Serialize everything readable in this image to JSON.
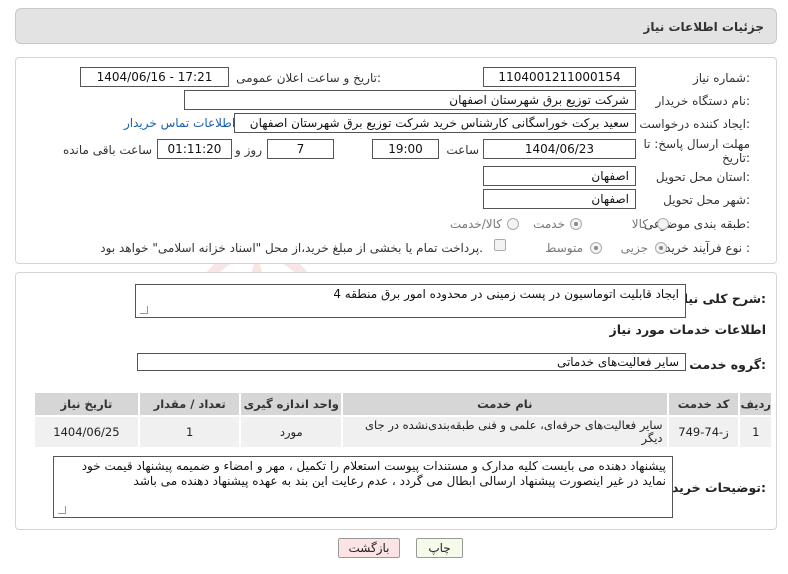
{
  "header": {
    "title": "جزئیات اطلاعات نیاز"
  },
  "watermark": {
    "text": "AriaTender.net"
  },
  "form": {
    "need_number_label": "شماره نیاز:",
    "need_number": "1104001211000154",
    "announce_label": "تاریخ و ساعت اعلان عمومی:",
    "announce_value": "1404/06/16 - 17:21",
    "buyer_org_label": "نام دستگاه خریدار:",
    "buyer_org": "شرکت توزیع برق شهرستان اصفهان",
    "creator_label": "ایجاد کننده درخواست:",
    "creator": "سعید برکت خوراسگانی کارشناس خرید شرکت توزیع برق شهرستان اصفهان",
    "buyer_contact_link": "اطلاعات تماس خریدار",
    "deadline_label_1": "مهلت ارسال پاسخ: تا",
    "deadline_label_2": "تاریخ:",
    "deadline_date": "1404/06/23",
    "time_label": "ساعت",
    "deadline_time": "19:00",
    "days_value": "7",
    "days_label": "روز و",
    "remaining_time": "01:11:20",
    "remaining_label": "ساعت باقی مانده",
    "province_label": "استان محل تحویل:",
    "province": "اصفهان",
    "city_label": "شهر محل تحویل:",
    "city": "اصفهان",
    "category_label": "طبقه بندی موضوعی:",
    "category_options": [
      "کالا",
      "خدمت",
      "کالا/خدمت"
    ],
    "category_selected": "خدمت",
    "process_label": "نوع فرآیند خرید :",
    "process_options": [
      "جزیی",
      "متوسط"
    ],
    "process_selected": "جزیی",
    "payment_note": "پرداخت تمام یا بخشی از مبلغ خرید،از محل \"اسناد خزانه اسلامی\" خواهد بود."
  },
  "summary": {
    "label": "شرح کلی نیاز:",
    "text": "ایجاد قابلیت اتوماسیون در پست زمینی در محدوده امور برق منطقه 4"
  },
  "services": {
    "section_title": "اطلاعات خدمات مورد نیاز",
    "group_label": "گروه خدمت:",
    "group_value": "سایر فعالیت‌های خدماتی",
    "columns": [
      "ردیف",
      "کد خدمت",
      "نام خدمت",
      "واحد اندازه گیری",
      "تعداد / مقدار",
      "تاریخ نیاز"
    ],
    "rows": [
      {
        "row": "1",
        "code": "ز-74-749",
        "name": "سایر فعالیت‌های حرفه‌ای، علمی و فنی طبقه‌بندی‌نشده در جای دیگر",
        "unit": "مورد",
        "qty": "1",
        "date": "1404/06/25"
      }
    ]
  },
  "buyer_notes": {
    "label": "توضیحات خریدار:",
    "text": "پیشنهاد دهنده می بایست کلیه مدارک و مستندات پیوست استعلام را تکمیل ، مهر و امضاء و ضمیمه پیشنهاد قیمت خود نماید در غیر اینصورت پیشنهاد ارسالی ابطال می گردد ، عدم رعایت این بند به عهده پیشنهاد دهنده می باشد"
  },
  "buttons": {
    "print": "چاپ",
    "back": "بازگشت"
  },
  "colors": {
    "print_bg": "#f4fbe9",
    "back_bg": "#fde4e4",
    "link": "#1b5fae"
  }
}
